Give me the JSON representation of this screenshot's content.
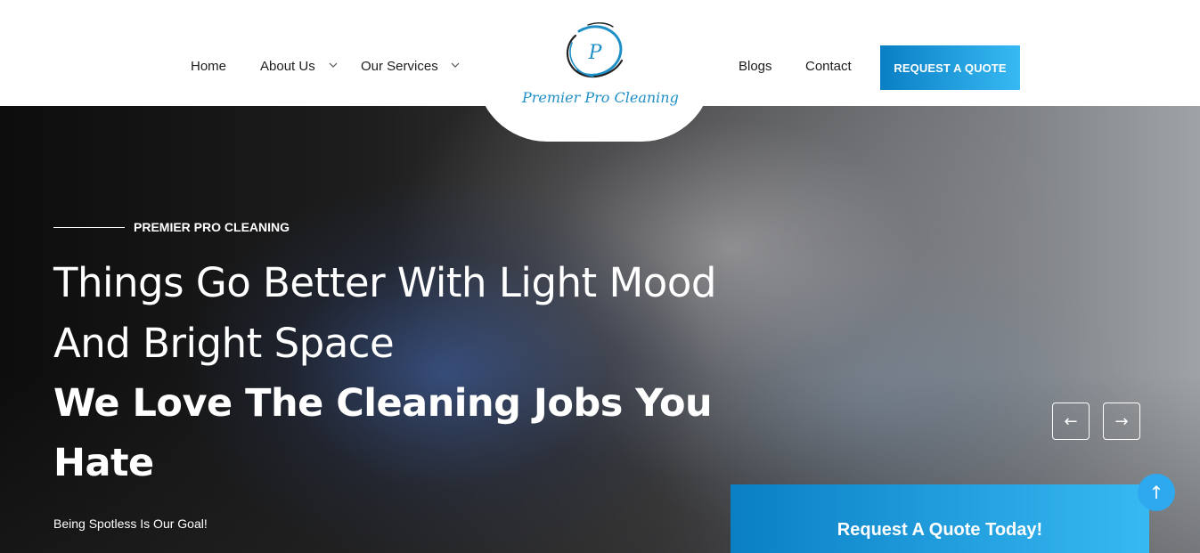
{
  "header": {
    "nav_left": [
      {
        "label": "Home"
      },
      {
        "label": "About Us",
        "has_dropdown": true
      },
      {
        "label": "Our Services",
        "has_dropdown": true
      }
    ],
    "nav_right": [
      {
        "label": "Blogs"
      },
      {
        "label": "Contact"
      }
    ],
    "logo": {
      "text": "Premier Pro Cleaning",
      "letter": "P"
    },
    "cta_label": "REQUEST A QUOTE"
  },
  "hero": {
    "eyebrow": "PREMIER PRO CLEANING",
    "headline_light_1": "Things Go Better With Light Mood",
    "headline_light_2": "And Bright Space",
    "headline_bold_1": "We Love The Cleaning Jobs You",
    "headline_bold_2": "Hate",
    "tagline": "Being Spotless Is Our Goal!",
    "prev_arrow": "←",
    "next_arrow": "→"
  },
  "quote_panel": {
    "title": "Request A Quote Today!"
  },
  "scroll_top": {
    "icon": "arrow-up-icon",
    "glyph": "↑"
  },
  "colors": {
    "accent_start": "#0a7fc4",
    "accent_end": "#37b9f3",
    "logo_blue": "#1f8fc7"
  }
}
